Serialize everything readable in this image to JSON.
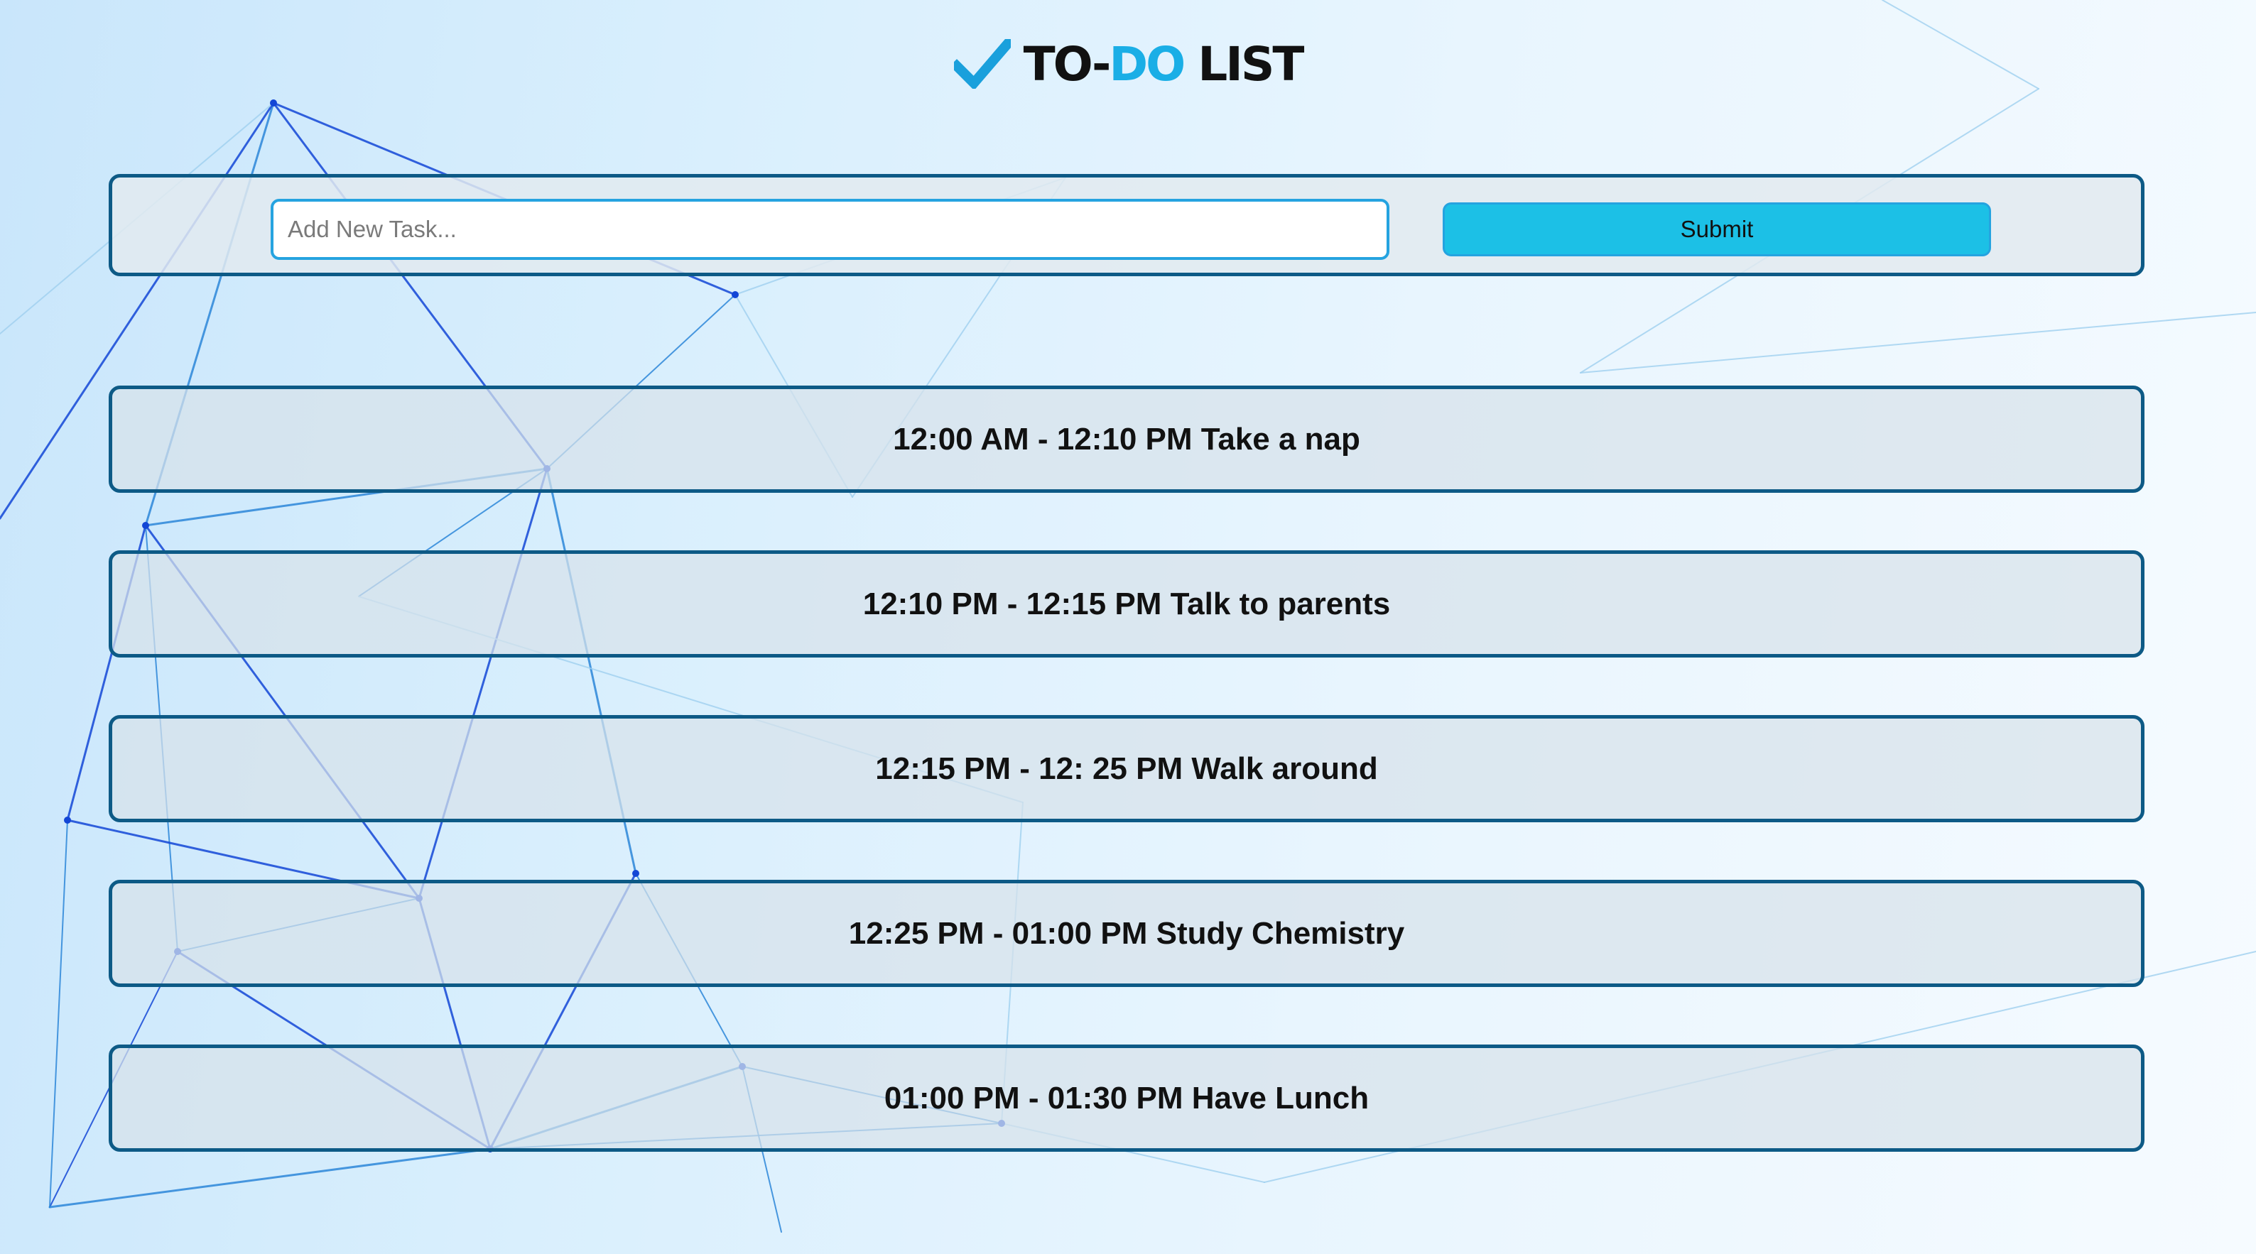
{
  "header": {
    "title_part1": "TO-",
    "title_accent": "DO",
    "title_part2": " LIST",
    "logo_icon": "checkmark-icon",
    "accent_color": "#1aaee6"
  },
  "form": {
    "placeholder": "Add New Task...",
    "value": "",
    "submit_label": "Submit"
  },
  "tasks": [
    {
      "text": "12:00 AM - 12:10 PM Take a nap"
    },
    {
      "text": "12:10 PM - 12:15 PM Talk to parents"
    },
    {
      "text": "12:15 PM - 12: 25 PM Walk around"
    },
    {
      "text": "12:25 PM - 01:00 PM Study Chemistry"
    },
    {
      "text": "01:00 PM - 01:30 PM Have Lunch"
    }
  ],
  "colors": {
    "border": "#0d5a86",
    "button": "#1cc0e6",
    "input_border": "#25a3e0"
  }
}
